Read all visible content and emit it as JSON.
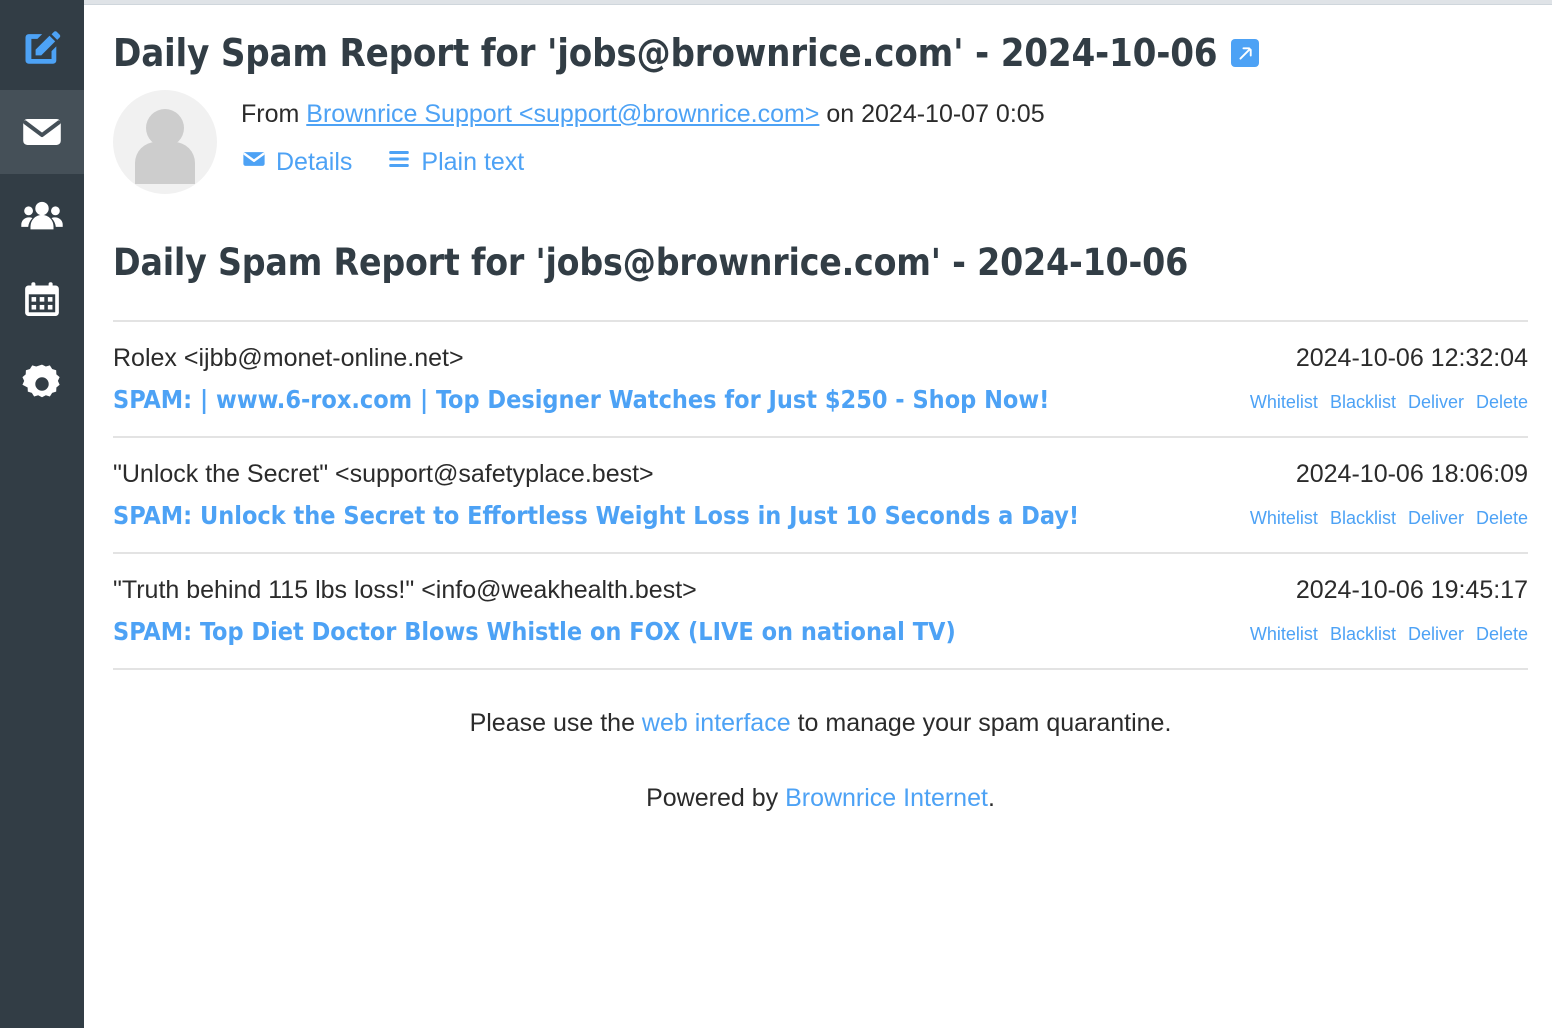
{
  "colors": {
    "sidebar_bg": "#323d45",
    "sidebar_active_bg": "#455058",
    "accent_blue": "#4da2f5",
    "text_dark": "#323d45",
    "body_text": "#2b2b2b",
    "divider": "#e3e3e3"
  },
  "sidebar": {
    "items": [
      {
        "name": "compose",
        "icon": "compose-pencil-icon",
        "active": false
      },
      {
        "name": "mail",
        "icon": "envelope-icon",
        "active": true
      },
      {
        "name": "contacts",
        "icon": "people-icon",
        "active": false
      },
      {
        "name": "calendar",
        "icon": "calendar-icon",
        "active": false
      },
      {
        "name": "settings",
        "icon": "gear-icon",
        "active": false
      }
    ]
  },
  "message": {
    "subject": "Daily Spam Report for 'jobs@brownrice.com' - 2024-10-06",
    "expand_icon": "expand-arrow-icon",
    "from_prefix": "From ",
    "from_name_email": "Brownrice Support <support@brownrice.com>",
    "on_text": " on ",
    "received": "2024-10-07 0:05",
    "details_label": "Details",
    "details_icon": "envelope-icon",
    "plain_text_label": "Plain text",
    "plain_text_icon": "lines-icon"
  },
  "body": {
    "heading": "Daily Spam Report for 'jobs@brownrice.com' - 2024-10-06",
    "row_actions": [
      "Whitelist",
      "Blacklist",
      "Deliver",
      "Delete"
    ],
    "rows": [
      {
        "sender": "Rolex <ijbb@monet-online.net>",
        "timestamp": "2024-10-06 12:32:04",
        "subject": "SPAM: | www.6-rox.com | Top Designer Watches for Just $250 - Shop Now!"
      },
      {
        "sender": "\"Unlock the Secret\" <support@safetyplace.best>",
        "timestamp": "2024-10-06 18:06:09",
        "subject": "SPAM: Unlock the Secret to Effortless Weight Loss in Just 10 Seconds a Day!"
      },
      {
        "sender": "\"Truth behind 115 lbs loss!\" <info@weakhealth.best>",
        "timestamp": "2024-10-06 19:45:17",
        "subject": "SPAM: Top Diet Doctor Blows Whistle on FOX (LIVE on national TV)"
      }
    ],
    "footer": {
      "line1_pre": "Please use the ",
      "line1_link": "web interface",
      "line1_post": " to manage your spam quarantine.",
      "line2_pre": "Powered by ",
      "line2_link": "Brownrice Internet",
      "line2_post": "."
    }
  }
}
